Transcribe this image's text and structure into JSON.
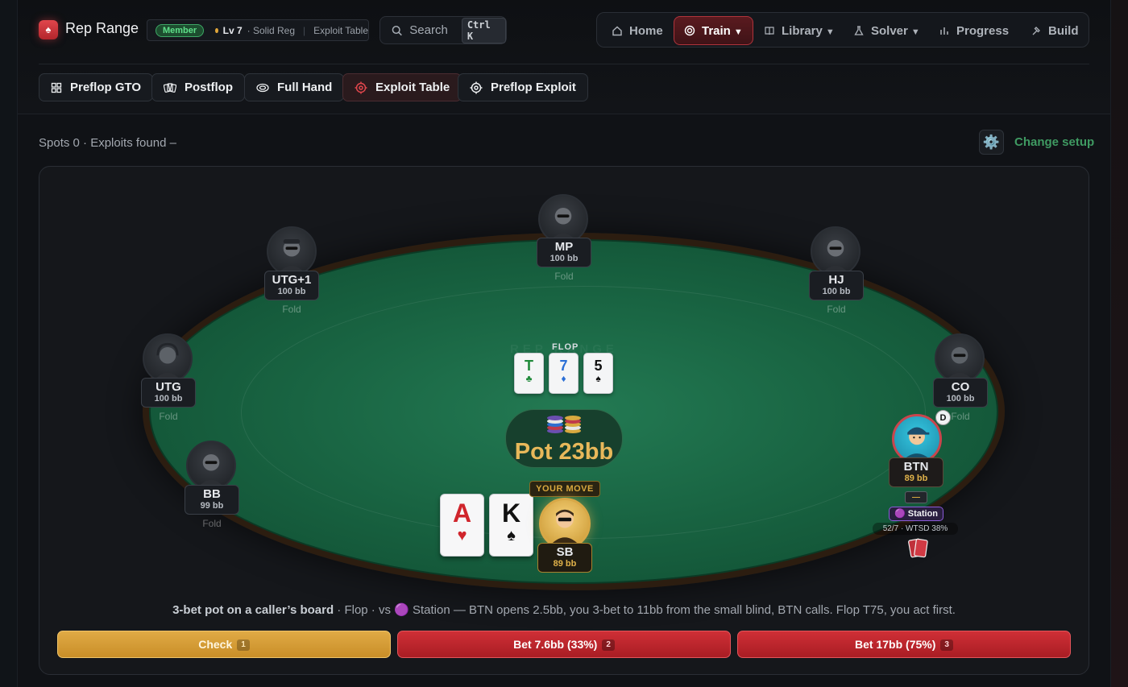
{
  "header": {
    "brand": "Rep Range",
    "member_badge": "Member",
    "level": "Lv 7",
    "level_desc": "· Solid Reg",
    "context": "Exploit Table",
    "search": {
      "label": "Search",
      "shortcut": "Ctrl K"
    },
    "nav": [
      {
        "label": "Home",
        "icon": "home-icon"
      },
      {
        "label": "Train",
        "icon": "target-icon",
        "dropdown": true,
        "active": true
      },
      {
        "label": "Library",
        "icon": "book-icon",
        "dropdown": true
      },
      {
        "label": "Solver",
        "icon": "flask-icon",
        "dropdown": true
      },
      {
        "label": "Progress",
        "icon": "bar-chart-icon"
      },
      {
        "label": "Build",
        "icon": "hammer-icon"
      }
    ]
  },
  "modes": [
    {
      "label": "Preflop GTO",
      "icon": "grid-icon"
    },
    {
      "label": "Postflop",
      "icon": "cards-icon"
    },
    {
      "label": "Full Hand",
      "icon": "chip-icon"
    },
    {
      "label": "Exploit Table",
      "icon": "crosshair-icon",
      "active": true
    },
    {
      "label": "Preflop Exploit",
      "icon": "target-icon"
    }
  ],
  "status": {
    "text": "Spots 0 · Exploits found –",
    "gear_icon": "⚙️",
    "change_setup": "Change setup"
  },
  "table": {
    "watermark": "REP RANGE",
    "street": "FLOP",
    "board": [
      {
        "rank": "T",
        "suit": "♣",
        "color": "#1f8a3a"
      },
      {
        "rank": "7",
        "suit": "♦",
        "color": "#2a6fd6"
      },
      {
        "rank": "5",
        "suit": "♠",
        "color": "#111111"
      }
    ],
    "pot_chips": "⛃⛃",
    "pot": "Pot 23bb",
    "seats": [
      {
        "pos": "UTG+1",
        "stack": "100 bb",
        "action": "Fold"
      },
      {
        "pos": "MP",
        "stack": "100 bb",
        "action": "Fold"
      },
      {
        "pos": "HJ",
        "stack": "100 bb",
        "action": "Fold"
      },
      {
        "pos": "UTG",
        "stack": "100 bb",
        "action": "Fold"
      },
      {
        "pos": "CO",
        "stack": "100 bb",
        "action": "Fold"
      },
      {
        "pos": "BB",
        "stack": "99 bb",
        "action": "Fold"
      }
    ],
    "hero": {
      "your_move": "YOUR MOVE",
      "pos": "SB",
      "stack": "89 bb",
      "cards": [
        {
          "rank": "A",
          "suit": "♥",
          "color": "#d0252c"
        },
        {
          "rank": "K",
          "suit": "♠",
          "color": "#111111"
        }
      ]
    },
    "villain": {
      "pos": "BTN",
      "stack": "89 bb",
      "dealer": "D",
      "bet": "—",
      "type": "🟣 Station",
      "stats": "52/7 · WTSD 38%"
    }
  },
  "description": {
    "bold": "3-bet pot on a caller’s board",
    "rest": " · Flop · vs 🟣 Station — BTN opens 2.5bb, you 3-bet to 11bb from the small blind, BTN calls. Flop T75, you act first."
  },
  "actions": [
    {
      "label": "Check",
      "key": "1"
    },
    {
      "label": "Bet 7.6bb (33%)",
      "key": "2"
    },
    {
      "label": "Bet 17bb (75%)",
      "key": "3"
    }
  ],
  "colors": {
    "accent": "#c9454d",
    "gold": "#e8b85a",
    "felt": "#1a6b47",
    "green_link": "#3f9a62"
  }
}
